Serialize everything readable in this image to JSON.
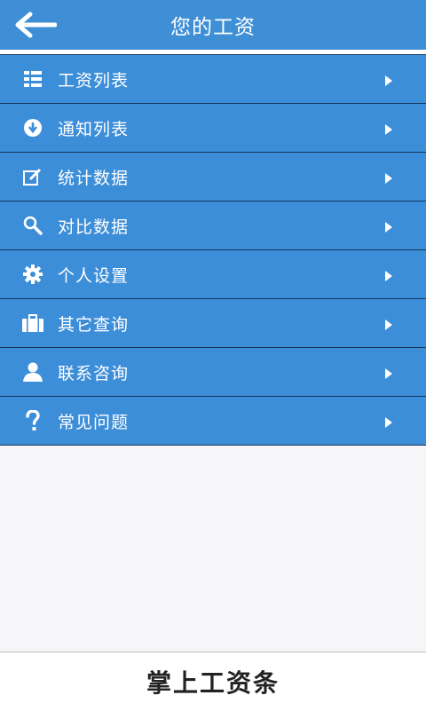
{
  "header": {
    "title": "您的工资"
  },
  "menu": {
    "items": [
      {
        "label": "工资列表",
        "icon": "grid-list-icon"
      },
      {
        "label": "通知列表",
        "icon": "download-circle-icon"
      },
      {
        "label": "统计数据",
        "icon": "edit-icon"
      },
      {
        "label": "对比数据",
        "icon": "search-icon"
      },
      {
        "label": "个人设置",
        "icon": "gear-icon"
      },
      {
        "label": "其它查询",
        "icon": "briefcase-icon"
      },
      {
        "label": "联系咨询",
        "icon": "user-icon"
      },
      {
        "label": "常见问题",
        "icon": "question-icon"
      }
    ]
  },
  "footer": {
    "brand": "掌上工资条"
  },
  "colors": {
    "header_bg": "#3f8fd6",
    "item_bg": "#3d8ed9",
    "background": "#f6f6f8"
  }
}
